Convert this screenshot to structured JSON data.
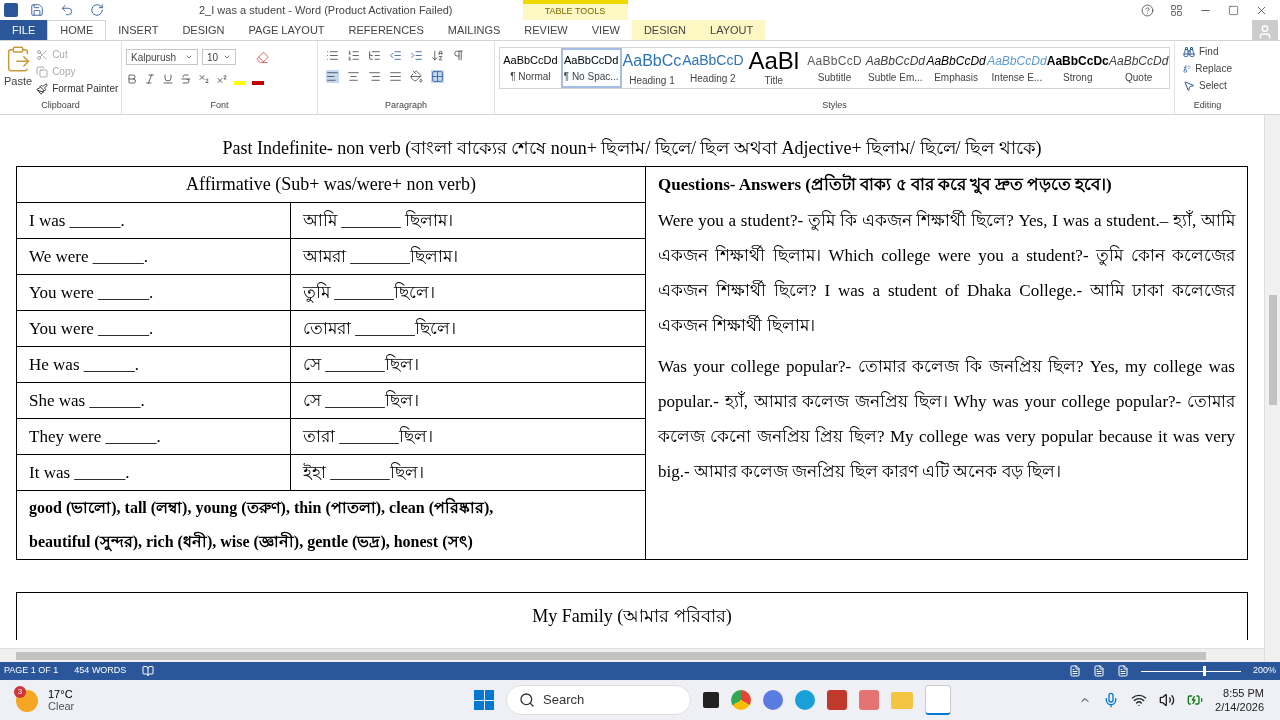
{
  "window": {
    "title": "2_I was a student - Word (Product Activation Failed)",
    "context_label": "TABLE TOOLS"
  },
  "tabs": [
    {
      "label": "FILE",
      "kind": "file",
      "selected": false
    },
    {
      "label": "HOME",
      "kind": "main",
      "selected": true
    },
    {
      "label": "INSERT",
      "kind": "main",
      "selected": false
    },
    {
      "label": "DESIGN",
      "kind": "main",
      "selected": false
    },
    {
      "label": "PAGE LAYOUT",
      "kind": "main",
      "selected": false
    },
    {
      "label": "REFERENCES",
      "kind": "main",
      "selected": false
    },
    {
      "label": "MAILINGS",
      "kind": "main",
      "selected": false
    },
    {
      "label": "REVIEW",
      "kind": "main",
      "selected": false
    },
    {
      "label": "VIEW",
      "kind": "main",
      "selected": false
    },
    {
      "label": "DESIGN",
      "kind": "context",
      "selected": false
    },
    {
      "label": "LAYOUT",
      "kind": "context",
      "selected": false
    }
  ],
  "clipboard": {
    "label": "Clipboard",
    "paste": "Paste",
    "items": [
      {
        "label": "Cut",
        "disabled": true
      },
      {
        "label": "Copy",
        "disabled": true
      },
      {
        "label": "Format Painter",
        "disabled": false
      }
    ]
  },
  "font": {
    "label": "Font",
    "name": "Kalpurush",
    "size": "10"
  },
  "paragraph": {
    "label": "Paragraph"
  },
  "styles": {
    "label": "Styles",
    "items": [
      {
        "preview": "AaBbCcDd",
        "label": "¶ Normal",
        "kind": "normal",
        "selected": false
      },
      {
        "preview": "AaBbCcDd",
        "label": "¶ No Spac...",
        "kind": "normal",
        "selected": true
      },
      {
        "preview": "AaBbCc",
        "label": "Heading 1",
        "kind": "heading1",
        "selected": false
      },
      {
        "preview": "AaBbCcD",
        "label": "Heading 2",
        "kind": "heading2",
        "selected": false
      },
      {
        "preview": "AaBl",
        "label": "Title",
        "kind": "title",
        "selected": false
      },
      {
        "preview": "AaBbCcD",
        "label": "Subtitle",
        "kind": "subtitle",
        "selected": false
      },
      {
        "preview": "AaBbCcDd",
        "label": "Subtle Em...",
        "kind": "subtle",
        "selected": false
      },
      {
        "preview": "AaBbCcDd",
        "label": "Emphasis",
        "kind": "emphasis",
        "selected": false
      },
      {
        "preview": "AaBbCcDd",
        "label": "Intense E...",
        "kind": "intense",
        "selected": false
      },
      {
        "preview": "AaBbCcDc",
        "label": "Strong",
        "kind": "strong",
        "selected": false
      },
      {
        "preview": "AaBbCcDd",
        "label": "Quote",
        "kind": "quote",
        "selected": false
      }
    ]
  },
  "editing": {
    "label": "Editing",
    "items": [
      "Find",
      "Replace",
      "Select"
    ]
  },
  "document": {
    "heading": "Past Indefinite- non verb (বাংলা বাক্যের শেষে noun+ ছিলাম/ ছিলে/ ছিল অথবা Adjective+ ছিলাম/ ছিলে/ ছিল থাকে)",
    "left_header": "Affirmative (Sub+ was/were+ non verb)",
    "rows": [
      {
        "english": "I was ______.",
        "bengali": "আমি _______ ছিলাম।"
      },
      {
        "english": "We were ______.",
        "bengali": "আমরা _______ছিলাম।"
      },
      {
        "english": "You were ______.",
        "bengali": "তুমি _______ছিলে।"
      },
      {
        "english": "You were ______.",
        "bengali": "তোমরা _______ছিলে।"
      },
      {
        "english": "He was ______.",
        "bengali": "সে _______ছিল।"
      },
      {
        "english": "She was ______.",
        "bengali": "সে _______ছিল।"
      },
      {
        "english": "They were ______.",
        "bengali": "তারা _______ছিল।"
      },
      {
        "english": "It was ______.",
        "bengali": "ইহা _______ছিল।"
      }
    ],
    "adjectives": [
      "good (ভালো), tall (লম্বা), young (তরুণ), thin (পাতলা), clean (পরিষ্কার),",
      "beautiful (সুন্দর), rich (ধনী), wise (জ্ঞানী), gentle (ভদ্র), honest (সৎ)"
    ],
    "right_header": "Questions- Answers (প্রতিটা বাক্য ৫ বার করে খুব দ্রুত পড়তে হবে।)",
    "paragraphs": [
      "Were you a student?- তুমি কি একজন শিক্ষার্থী ছিলে? Yes, I was a student.– হ্যাঁ, আমি একজন শিক্ষার্থী ছিলাম। Which college were you a student?- তুমি কোন কলেজের একজন শিক্ষার্থী ছিলে? I was a student of Dhaka College.- আমি ঢাকা কলেজের একজন শিক্ষার্থী ছিলাম।",
      "Was your college popular?- তোমার কলেজ কি জনপ্রিয় ছিল? Yes, my college was popular.- হ্যাঁ, আমার কলেজ জনপ্রিয় ছিল। Why was your college popular?- তোমার কলেজ কেনো জনপ্রিয় প্রিয় ছিল? My college was very popular because it was very big.- আমার কলেজ জনপ্রিয় ছিল কারণ এটি অনেক বড় ছিল।"
    ],
    "next_heading": "My Family (আমার পরিবার)"
  },
  "status_bar": {
    "page": "PAGE 1 OF 1",
    "words": "454 WORDS",
    "zoom": "200%",
    "level": 0.62
  },
  "taskbar": {
    "temperature": "17°C",
    "weather": "Clear",
    "badge": "3",
    "search": "Search",
    "time": "8:55 PM",
    "date": "2/14/2026"
  }
}
